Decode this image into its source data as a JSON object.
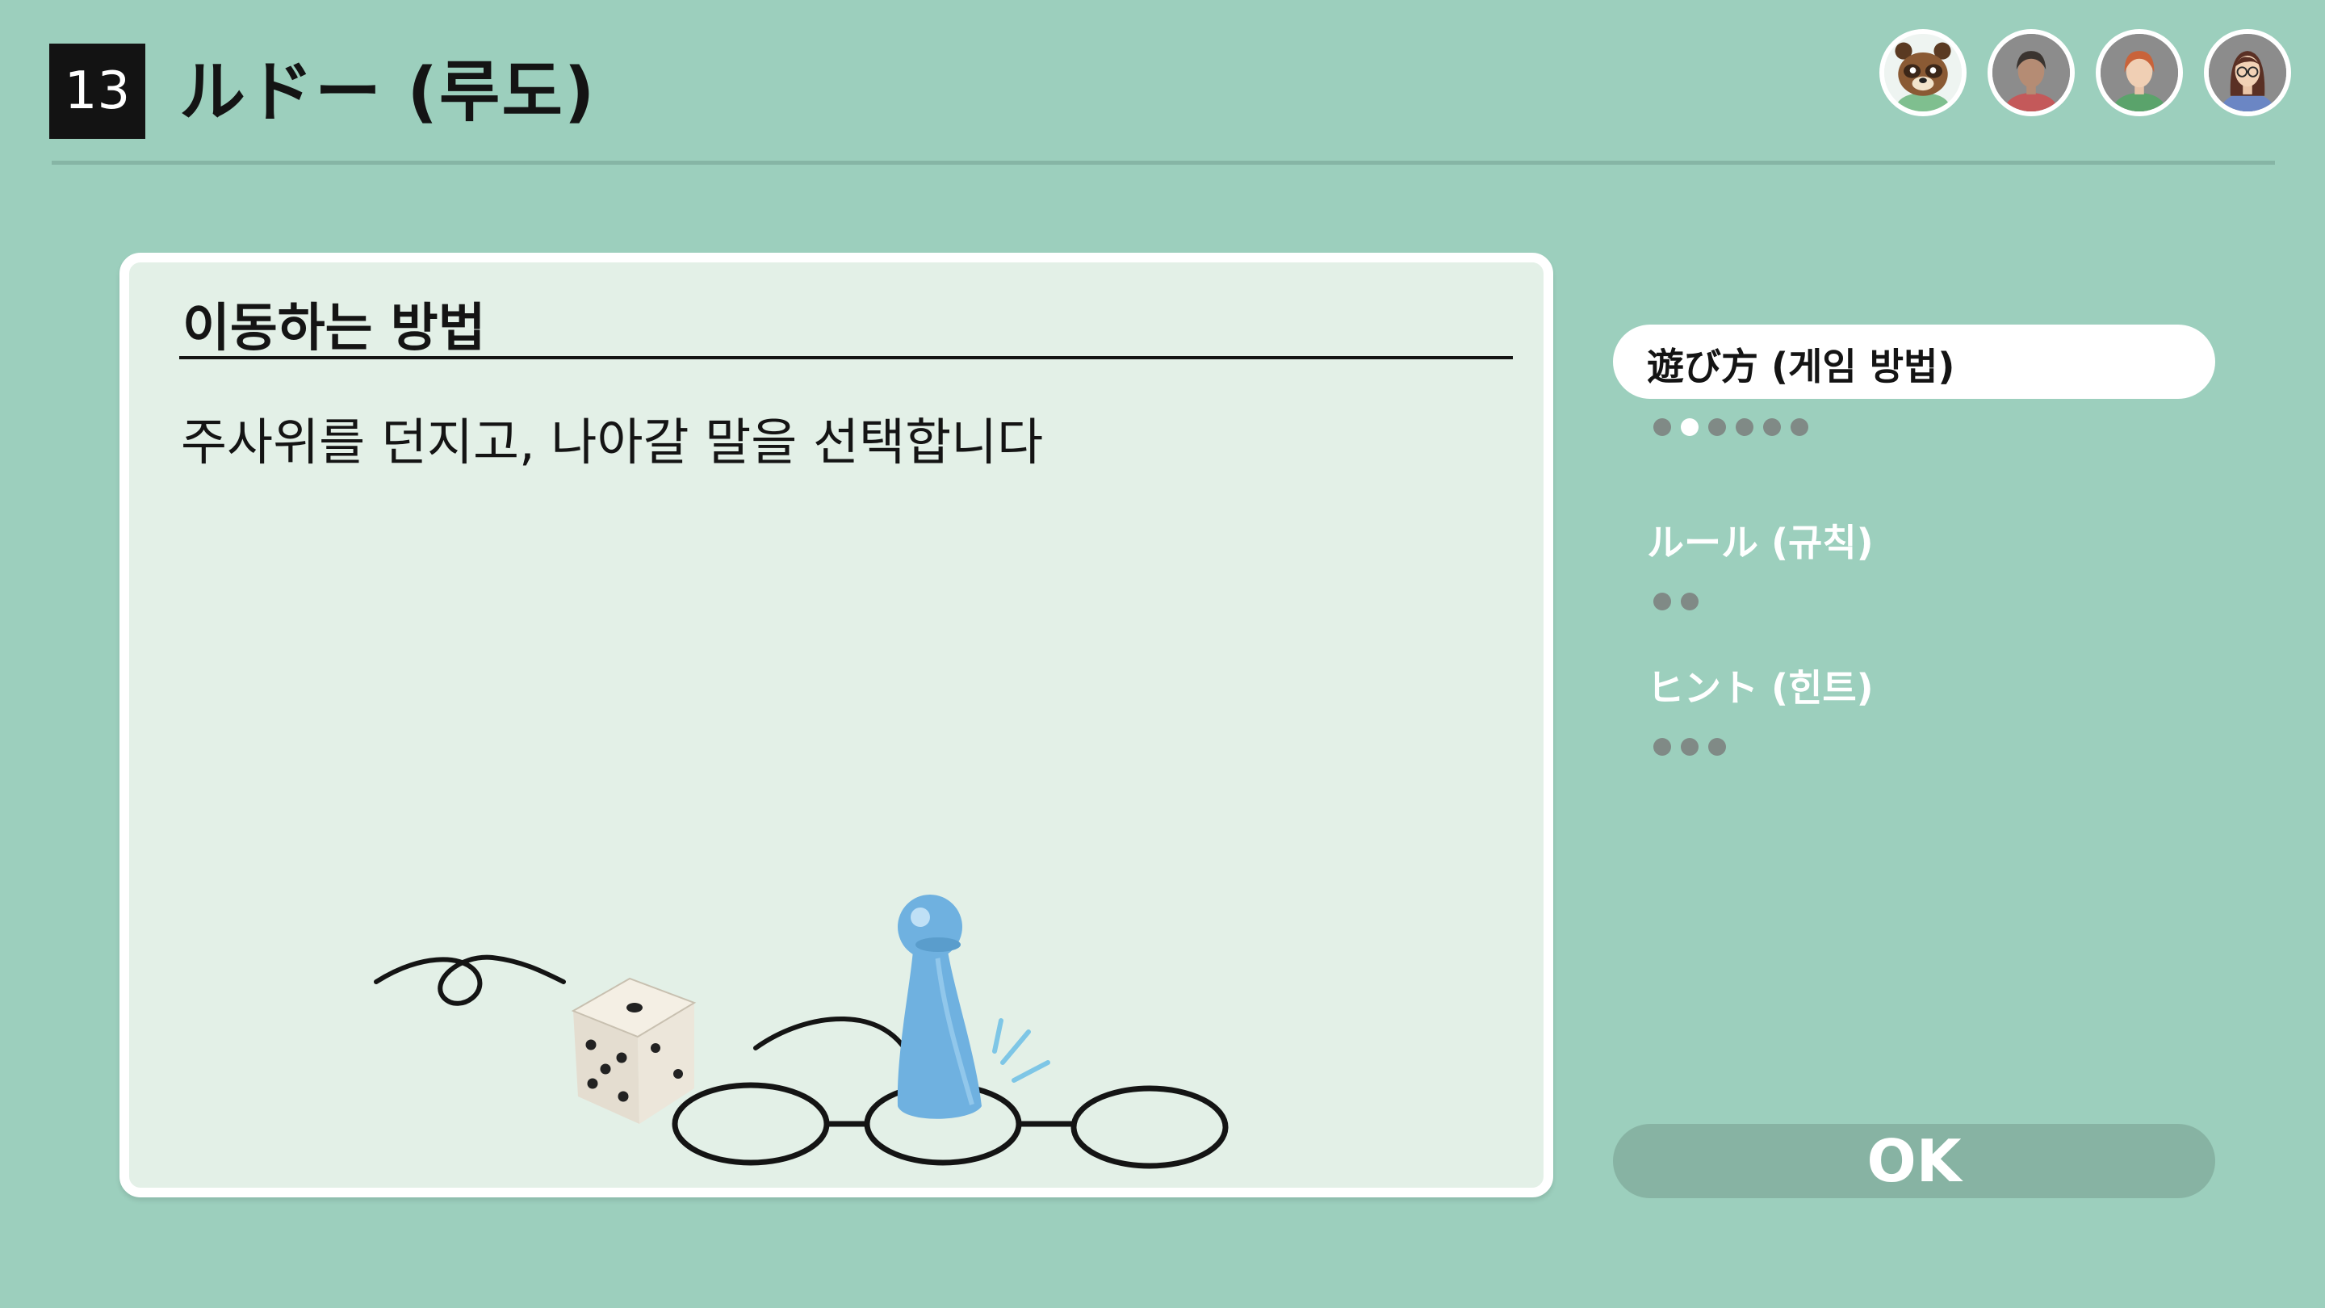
{
  "header": {
    "game_number": "13",
    "game_title": "ルドー (루도)"
  },
  "players": [
    {
      "icon": "tom-nook-avatar-icon"
    },
    {
      "icon": "dark-hair-avatar-icon"
    },
    {
      "icon": "red-hair-avatar-icon"
    },
    {
      "icon": "glasses-avatar-icon"
    }
  ],
  "card": {
    "heading": "이동하는 방법",
    "text": "주사위를 던지고, 나아갈 말을 선택합니다"
  },
  "nav": {
    "items": [
      {
        "label": "遊び方 (게임 방법)",
        "page_count": 6,
        "current_page": 2,
        "selected": true
      },
      {
        "label": "ルール (규칙)",
        "page_count": 2,
        "selected": false
      },
      {
        "label": "ヒント (힌트)",
        "page_count": 3,
        "selected": false
      }
    ]
  },
  "ok_button": {
    "label": "OK"
  },
  "colors": {
    "background": "#9ccfbd",
    "card": "#e3f0e7",
    "text": "#141414",
    "dot_inactive": "#808a86",
    "ok_button": "#87b3a3",
    "pawn": "#6fb1e0",
    "motion_lines": "#7ec6e6"
  }
}
